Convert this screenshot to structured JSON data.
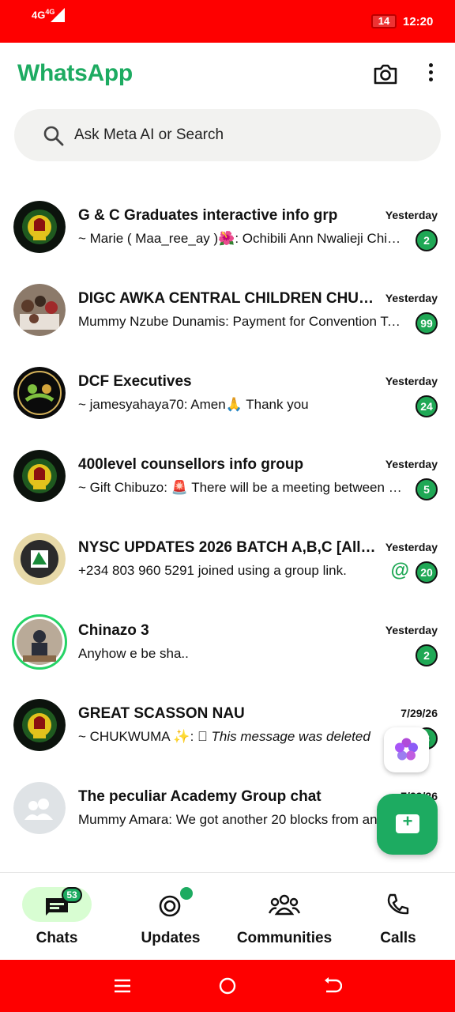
{
  "status_bar": {
    "network": "4G",
    "network_sup": "4G",
    "battery": "14",
    "time": "12:20"
  },
  "header": {
    "title": "WhatsApp",
    "camera_icon": "camera-icon",
    "menu_icon": "more-vert-icon"
  },
  "search": {
    "placeholder": "Ask Meta AI or Search"
  },
  "chats": [
    {
      "name": "G & C Graduates interactive info grp",
      "time": "Yesterday",
      "message": "~ Marie ( Maa_ree_ay )🌺: Ochibili Ann Nwalieji Chidi…",
      "unread": "2"
    },
    {
      "name": "DIGC AWKA CENTRAL CHILDREN CHURCH",
      "time": "Yesterday",
      "message": "Mummy Nzube Dunamis: Payment for Convention Te…",
      "unread": "99"
    },
    {
      "name": "DCF Executives",
      "time": "Yesterday",
      "message": "~ jamesyahaya70: Amen🙏 Thank you",
      "unread": "24"
    },
    {
      "name": "400level counsellors info group",
      "time": "Yesterday",
      "message": "~ Gift Chibuzo: 🚨 There will be a meeting between t…",
      "unread": "5"
    },
    {
      "name": "NYSC UPDATES 2026 BATCH A,B,C [All Str…",
      "time": "Yesterday",
      "message": "+234 803 960 5291 joined using a group link.",
      "unread": "20",
      "mention": "@"
    },
    {
      "name": "Chinazo 3",
      "time": "Yesterday",
      "message": "Anyhow e be sha..",
      "unread": "2"
    },
    {
      "name": "GREAT SCASSON NAU",
      "time": "7/29/26",
      "message_prefix": "~ CHUKWUMA ✨: ⃠ ",
      "message_deleted": "This message was deleted",
      "unread": "8"
    },
    {
      "name": "The peculiar Academy Group chat",
      "time": "7/29/26",
      "message": "Mummy Amara: We got another 20 blocks from an…"
    }
  ],
  "bottom_nav": {
    "chats_label": "Chats",
    "chats_count": "53",
    "updates_label": "Updates",
    "communities_label": "Communities",
    "calls_label": "Calls"
  },
  "colors": {
    "brand": "#1dab61",
    "status_bar": "#fe0000",
    "badge": "#1fa855",
    "active_pill": "#d8fdd2"
  }
}
